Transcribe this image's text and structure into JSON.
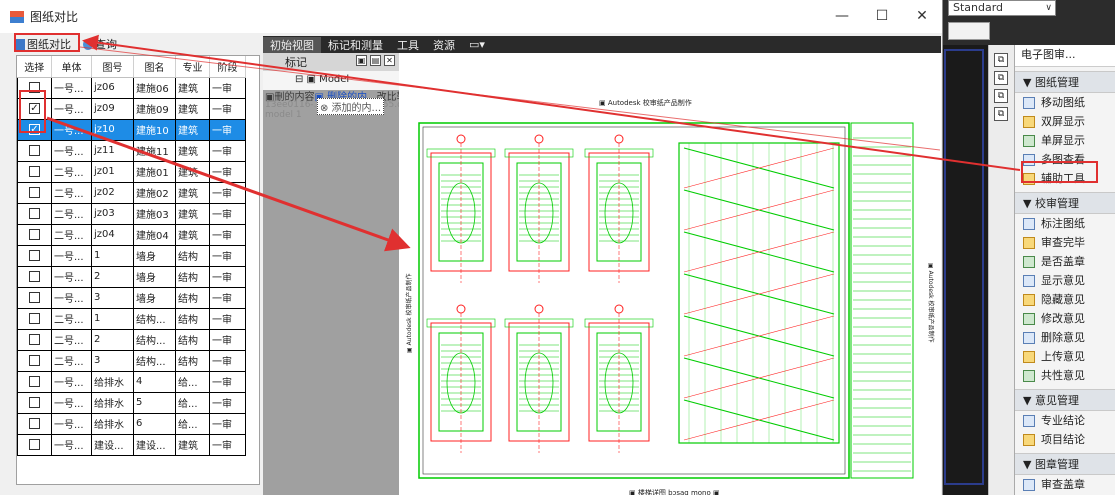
{
  "window": {
    "title": "图纸对比",
    "minimize": "—",
    "maximize": "☐",
    "close": "✕"
  },
  "left_toolbar": {
    "compare_label": "图纸对比",
    "query_label": "查询"
  },
  "grid": {
    "columns": [
      "选择",
      "单体",
      "图号",
      "图名",
      "专业",
      "阶段"
    ],
    "rows": [
      {
        "checked": false,
        "single": "一号...",
        "no": "jz06",
        "name": "建施06",
        "major": "建筑",
        "stage": "一审",
        "selected": false
      },
      {
        "checked": true,
        "single": "一号...",
        "no": "jz09",
        "name": "建施09",
        "major": "建筑",
        "stage": "一审",
        "selected": false
      },
      {
        "checked": true,
        "single": "一号...",
        "no": "jz10",
        "name": "建施10",
        "major": "建筑",
        "stage": "一审",
        "selected": true
      },
      {
        "checked": false,
        "single": "一号...",
        "no": "jz11",
        "name": "建施11",
        "major": "建筑",
        "stage": "一审",
        "selected": false
      },
      {
        "checked": false,
        "single": "二号...",
        "no": "jz01",
        "name": "建施01",
        "major": "建筑",
        "stage": "一审",
        "selected": false
      },
      {
        "checked": false,
        "single": "二号...",
        "no": "jz02",
        "name": "建施02",
        "major": "建筑",
        "stage": "一审",
        "selected": false
      },
      {
        "checked": false,
        "single": "二号...",
        "no": "jz03",
        "name": "建施03",
        "major": "建筑",
        "stage": "一审",
        "selected": false
      },
      {
        "checked": false,
        "single": "二号...",
        "no": "jz04",
        "name": "建施04",
        "major": "建筑",
        "stage": "一审",
        "selected": false
      },
      {
        "checked": false,
        "single": "一号...",
        "no": "1",
        "name": "墙身",
        "major": "结构",
        "stage": "一审",
        "selected": false
      },
      {
        "checked": false,
        "single": "一号...",
        "no": "2",
        "name": "墙身",
        "major": "结构",
        "stage": "一审",
        "selected": false
      },
      {
        "checked": false,
        "single": "一号...",
        "no": "3",
        "name": "墙身",
        "major": "结构",
        "stage": "一审",
        "selected": false
      },
      {
        "checked": false,
        "single": "二号...",
        "no": "1",
        "name": "结构...",
        "major": "结构",
        "stage": "一审",
        "selected": false
      },
      {
        "checked": false,
        "single": "二号...",
        "no": "2",
        "name": "结构...",
        "major": "结构",
        "stage": "一审",
        "selected": false
      },
      {
        "checked": false,
        "single": "二号...",
        "no": "3",
        "name": "结构...",
        "major": "结构",
        "stage": "一审",
        "selected": false
      },
      {
        "checked": false,
        "single": "一号...",
        "no": "给排水",
        "name": "4",
        "major": "给...",
        "stage": "一审",
        "selected": false
      },
      {
        "checked": false,
        "single": "一号...",
        "no": "给排水",
        "name": "5",
        "major": "给...",
        "stage": "一审",
        "selected": false
      },
      {
        "checked": false,
        "single": "一号...",
        "no": "给排水",
        "name": "6",
        "major": "给...",
        "stage": "一审",
        "selected": false
      },
      {
        "checked": false,
        "single": "一号...",
        "no": "建设...",
        "name": "建设...",
        "major": "建筑",
        "stage": "一审",
        "selected": false
      }
    ]
  },
  "viewer": {
    "tabs": [
      "初始视图",
      "标记和测量",
      "工具",
      "资源",
      "▭▾"
    ],
    "panel_title": "标记",
    "tree_item": "⊟ ▣ Model",
    "overlay_line1_prefix": "▣刪的内容",
    "overlay_line1_link": "▣ 删除的内...",
    "overlay_line1_suffix": "改比较",
    "overlay_line2": "13ee0116-...-0932d8424455.dwf",
    "overlay_line3": "model 1",
    "overlay_added": "⊗ 添加的内...",
    "drawing_header": "▣ Autodesk 校审纸产品制作",
    "drawing_footer": "▣ 楼梯详图 bɔsaq mono ▣",
    "drawing_side_left": "▣ Autodesk 校审纸产品制作",
    "drawing_side_right": "▣ Autodesk 校审纸产品制作"
  },
  "background_app": {
    "style_combo": "Standard"
  },
  "right_panel": {
    "title": "电子图审...",
    "sections": [
      {
        "title": "▼ 图纸管理",
        "items": [
          "移动图纸",
          "双屏显示",
          "单屏显示",
          "多图查看",
          "辅助工具"
        ]
      },
      {
        "title": "▼ 校审管理",
        "items": [
          "标注图纸",
          "审查完毕",
          "是否盖章",
          "显示意见",
          "隐藏意见",
          "修改意见",
          "删除意见",
          "上传意见",
          "共性意见"
        ]
      },
      {
        "title": "▼ 意见管理",
        "items": [
          "专业结论",
          "项目结论"
        ]
      },
      {
        "title": "▼ 图章管理",
        "items": [
          "审查盖章"
        ]
      }
    ]
  },
  "colors": {
    "selection": "#1e8ce6",
    "annotation_red": "#e03030",
    "cad_green": "#00cc00",
    "cad_red": "#ff2020"
  }
}
